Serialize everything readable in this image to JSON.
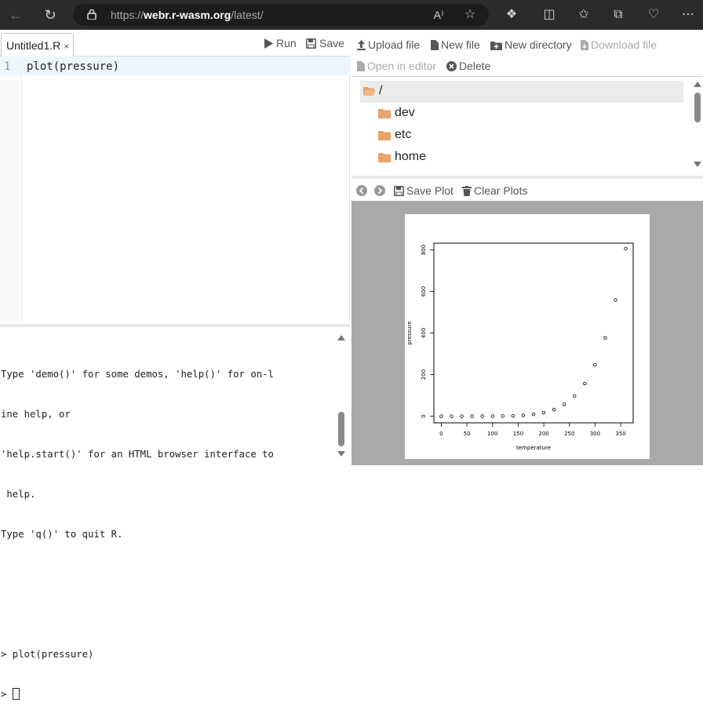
{
  "browser": {
    "url_prefix": "https://",
    "url_domain": "webr.r-wasm.org",
    "url_path": "/latest/"
  },
  "editor": {
    "tab_label": "Untitled1.R",
    "tab_close": "×",
    "run_label": "Run",
    "save_label": "Save",
    "line_number": "1",
    "code": "plot(pressure)"
  },
  "console": {
    "lines": [
      "Type 'demo()' for some demos, 'help()' for on-l",
      "ine help, or",
      "'help.start()' for an HTML browser interface to",
      " help.",
      "Type 'q()' to quit R.",
      "",
      "",
      "> plot(pressure)",
      "> "
    ]
  },
  "files": {
    "upload_label": "Upload file",
    "new_file_label": "New file",
    "new_dir_label": "New directory",
    "download_label": "Download file",
    "open_editor_label": "Open in editor",
    "delete_label": "Delete",
    "tree": [
      "/",
      "dev",
      "etc",
      "home"
    ]
  },
  "plots": {
    "save_label": "Save Plot",
    "clear_label": "Clear Plots"
  },
  "colors": {
    "folder": "#e8a46c",
    "accent": "#2b2b2b"
  },
  "chart_data": {
    "type": "scatter",
    "xlabel": "temperature",
    "ylabel": "pressure",
    "xlim": [
      0,
      360
    ],
    "ylim": [
      0,
      800
    ],
    "xticks": [
      0,
      50,
      100,
      150,
      200,
      250,
      300,
      350
    ],
    "yticks": [
      0,
      200,
      400,
      600,
      800
    ],
    "x": [
      0,
      20,
      40,
      60,
      80,
      100,
      120,
      140,
      160,
      180,
      200,
      220,
      240,
      260,
      280,
      300,
      320,
      340,
      360
    ],
    "y": [
      0.0002,
      0.0012,
      0.006,
      0.03,
      0.09,
      0.27,
      0.75,
      1.85,
      4.2,
      8.8,
      17.3,
      32.1,
      57,
      96,
      157,
      247,
      376,
      558,
      806
    ]
  }
}
